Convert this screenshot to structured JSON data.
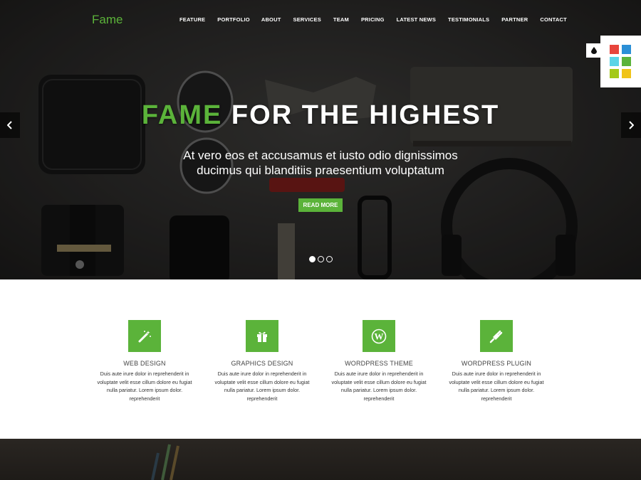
{
  "brand": "Fame",
  "nav": [
    "FEATURE",
    "PORTFOLIO",
    "ABOUT",
    "SERVICES",
    "TEAM",
    "PRICING",
    "LATEST NEWS",
    "TESTIMONIALS",
    "PARTNER",
    "CONTACT"
  ],
  "hero": {
    "title_accent": "FAME",
    "title_rest": " FOR THE HIGHEST",
    "subtitle_line1": "At vero eos et accusamus et iusto odio dignissimos",
    "subtitle_line2": "ducimus qui blanditiis praesentium voluptatum",
    "button": "READ MORE",
    "slides": 3,
    "active_slide": 1
  },
  "switcher_colors": [
    "#e8453c",
    "#2b8fd6",
    "#5bd4e6",
    "#5bb33a",
    "#a4c918",
    "#f0c419"
  ],
  "services": [
    {
      "icon": "magic-wand-icon",
      "title": "WEB DESIGN",
      "text": "Duis aute irure dolor in reprehenderit in voluptate velit esse cillum dolore eu fugiat nulla pariatur. Lorem ipsum dolor. reprehenderit"
    },
    {
      "icon": "gift-icon",
      "title": "GRAPHICS DESIGN",
      "text": "Duis aute irure dolor in reprehenderit in voluptate velit esse cillum dolore eu fugiat nulla pariatur. Lorem ipsum dolor. reprehenderit"
    },
    {
      "icon": "wordpress-icon",
      "title": "WORDPRESS THEME",
      "text": "Duis aute irure dolor in reprehenderit in voluptate velit esse cillum dolore eu fugiat nulla pariatur. Lorem ipsum dolor. reprehenderit"
    },
    {
      "icon": "plug-icon",
      "title": "WORDPRESS PLUGIN",
      "text": "Duis aute irure dolor in reprehenderit in voluptate velit esse cillum dolore eu fugiat nulla pariatur. Lorem ipsum dolor. reprehenderit"
    }
  ],
  "colors": {
    "accent": "#5bb33a"
  }
}
